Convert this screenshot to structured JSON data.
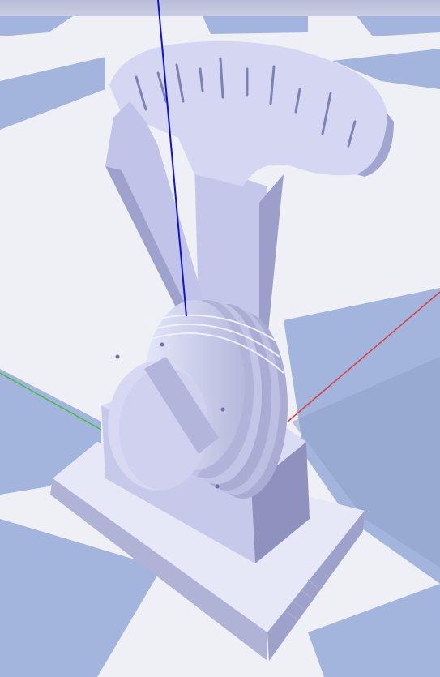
{
  "scene": {
    "colors": {
      "sky": "#c8cbe2",
      "floor_light": "#eef0f6",
      "floor_blue": "#9fb3dc",
      "model": "#c9cceb",
      "model_light": "#dfe1f6",
      "model_shadow": "#a8abd0",
      "axis_x": "#e23a3a",
      "axis_y": "#3cc23c",
      "axis_z": "#1010e0"
    },
    "objects": [
      "dial-gauge",
      "drum",
      "base-plate",
      "pointer-arm"
    ]
  }
}
